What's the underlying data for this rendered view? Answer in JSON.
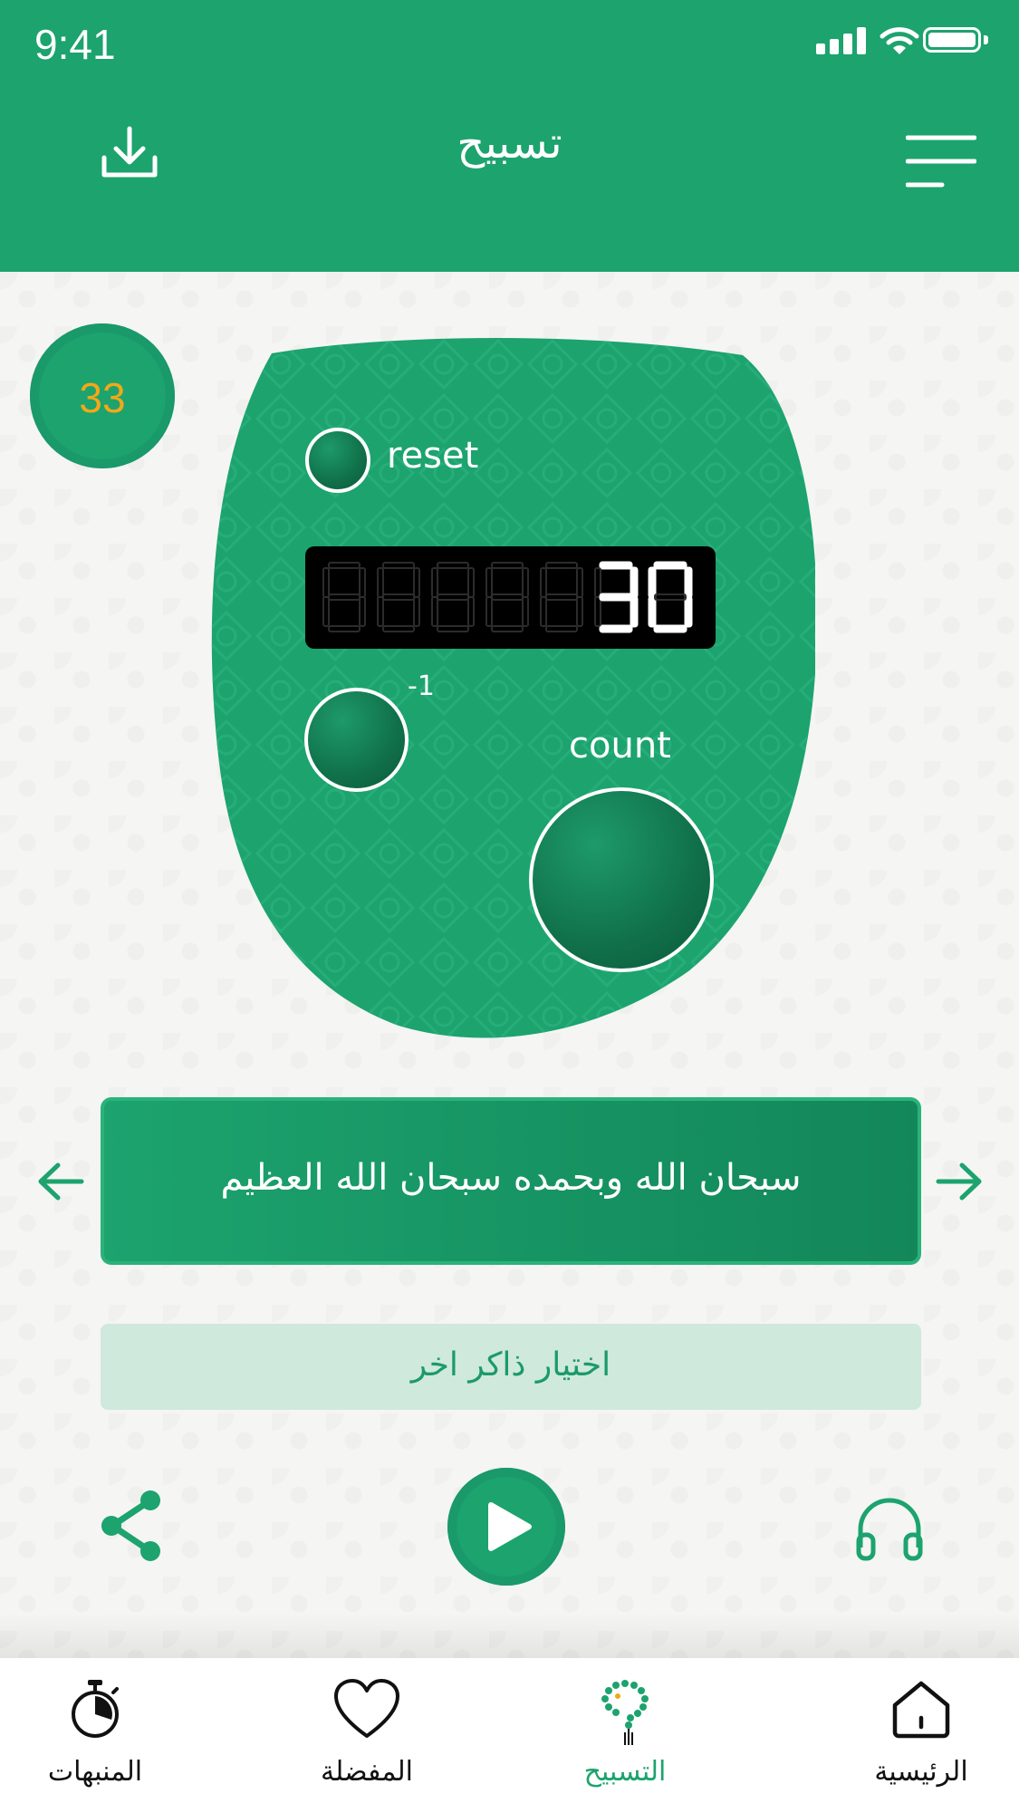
{
  "status_bar": {
    "time": "9:41"
  },
  "header": {
    "title": "تسبيح"
  },
  "counter": {
    "target": "33",
    "reset_label": "reset",
    "minus_label": "-1",
    "count_label": "count",
    "display_value": "30"
  },
  "dhikr": {
    "text": "سبحان الله وبحمده سبحان الله العظيم",
    "choose_label": "اختيار ذاكر اخر"
  },
  "tabs": [
    {
      "label": "المنبهات",
      "icon": "stopwatch-icon"
    },
    {
      "label": "المفضلة",
      "icon": "heart-icon"
    },
    {
      "label": "التسبيح",
      "icon": "prayer-beads-icon",
      "active": true
    },
    {
      "label": "الرئيسية",
      "icon": "home-icon"
    }
  ],
  "colors": {
    "primary": "#1ca36e",
    "badge_text": "#f2a818",
    "tab_active": "#1ca36e"
  }
}
